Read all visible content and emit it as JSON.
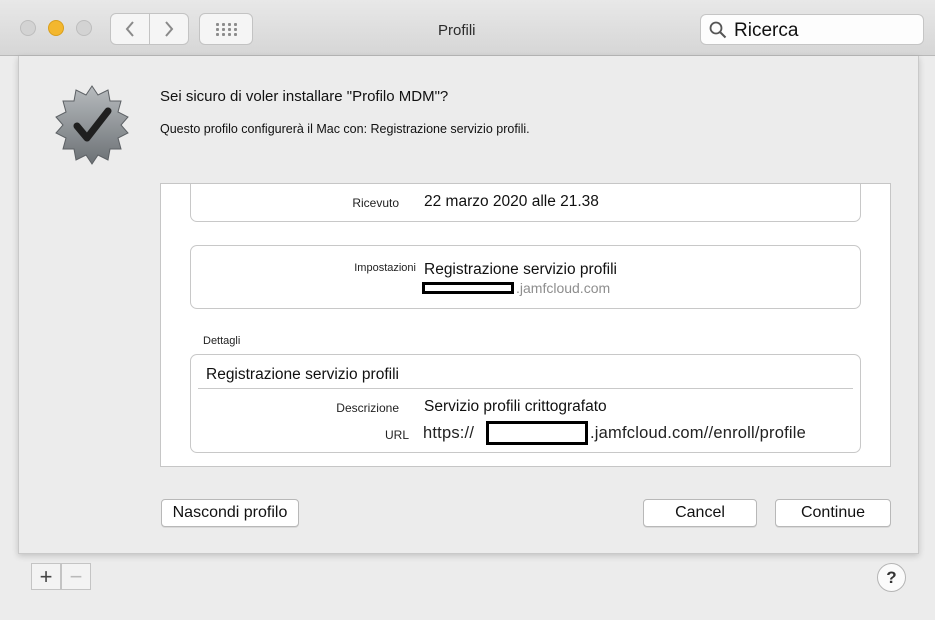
{
  "window": {
    "title": "Profili"
  },
  "search": {
    "placeholder": "Ricerca"
  },
  "dialog": {
    "question": "Sei sicuro di voler installare \"Profilo MDM\"?",
    "subtext": "Questo profilo configurerà il Mac con: Registrazione servizio profili.",
    "received_label": "Ricevuto",
    "received_value": "22 marzo 2020 alle 21.38",
    "settings_label": "Impostazioni",
    "settings_value": "Registrazione servizio profili",
    "settings_domain": ".jamfcloud.com",
    "details_heading": "Dettagli",
    "details_title": "Registrazione servizio profili",
    "description_label": "Descrizione",
    "description_value": "Servizio profili crittografato",
    "url_label": "URL",
    "url_prefix": "https://",
    "url_suffix": ".jamfcloud.com//enroll/profile"
  },
  "buttons": {
    "hide": "Nascondi profilo",
    "cancel": "Cancel",
    "continue": "Continue"
  },
  "bottom_bar": {
    "plus": "+",
    "minus": "−",
    "help": "?"
  },
  "colors": {
    "minimize_yellow": "#f3b72e",
    "badge_gray": "#8a8f93"
  }
}
